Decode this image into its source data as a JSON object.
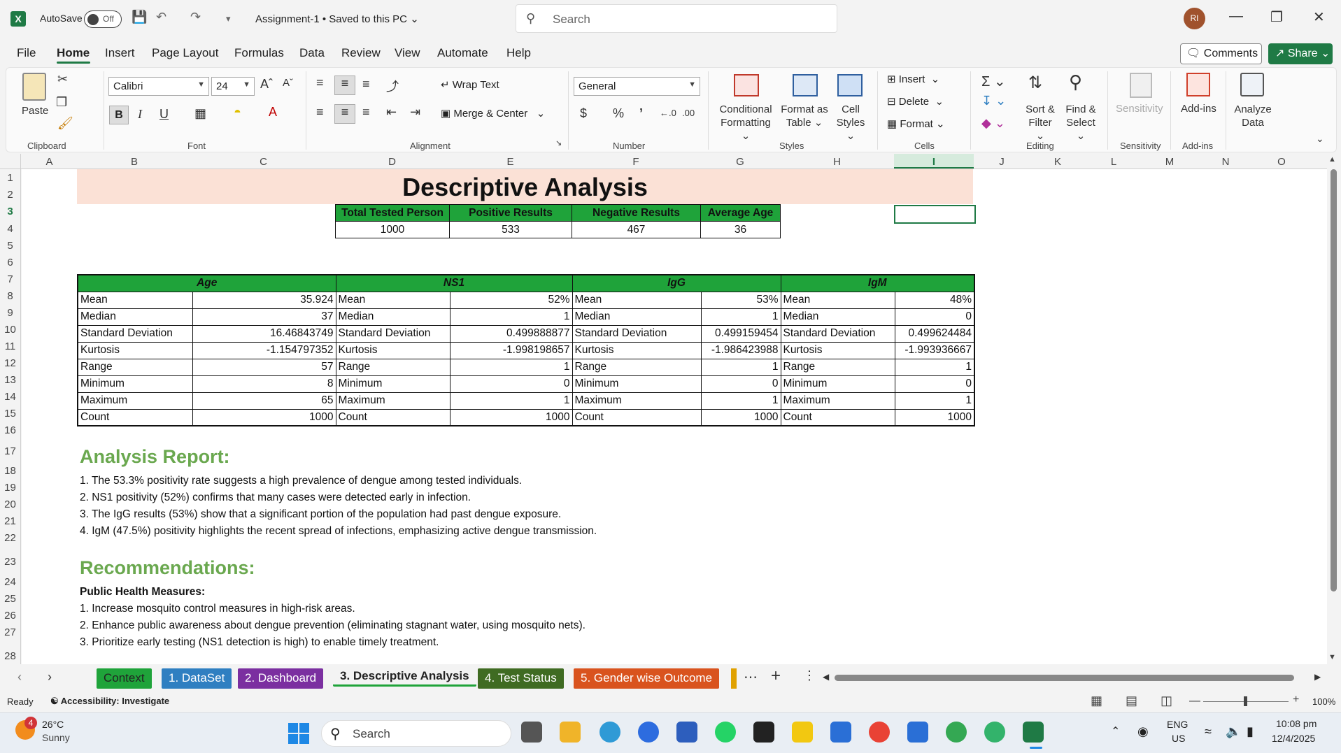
{
  "titlebar": {
    "autosave_label": "AutoSave",
    "autosave_state": "Off",
    "doc_title": "Assignment-1 • Saved to this PC",
    "search_placeholder": "Search",
    "avatar_initials": "RI"
  },
  "menu": {
    "tabs": [
      "File",
      "Home",
      "Insert",
      "Page Layout",
      "Formulas",
      "Data",
      "Review",
      "View",
      "Automate",
      "Help"
    ],
    "active": "Home",
    "comments_label": "Comments",
    "share_label": "Share"
  },
  "ribbon": {
    "paste_label": "Paste",
    "clipboard_group": "Clipboard",
    "font_name": "Calibri",
    "font_size": "24",
    "font_group": "Font",
    "wrap_text": "Wrap Text",
    "merge_center": "Merge & Center",
    "alignment_group": "Alignment",
    "number_format": "General",
    "number_group": "Number",
    "conditional_formatting": [
      "Conditional",
      "Formatting"
    ],
    "format_as_table": [
      "Format as",
      "Table"
    ],
    "cell_styles": [
      "Cell",
      "Styles"
    ],
    "styles_group": "Styles",
    "insert_label": "Insert",
    "delete_label": "Delete",
    "format_label": "Format",
    "cells_group": "Cells",
    "sort_filter": [
      "Sort &",
      "Filter"
    ],
    "find_select": [
      "Find &",
      "Select"
    ],
    "editing_group": "Editing",
    "sensitivity_label": "Sensitivity",
    "sensitivity_group": "Sensitivity",
    "addins_label": "Add-ins",
    "addins_group": "Add-ins",
    "analyze_data": [
      "Analyze",
      "Data"
    ],
    "accent_color": "#1f7a45"
  },
  "columns": [
    "A",
    "B",
    "C",
    "D",
    "E",
    "F",
    "G",
    "H",
    "I",
    "J",
    "K",
    "L",
    "M",
    "N",
    "O"
  ],
  "rows": [
    "1",
    "2",
    "3",
    "4",
    "5",
    "6",
    "7",
    "8",
    "9",
    "10",
    "11",
    "12",
    "13",
    "14",
    "15",
    "16",
    "17",
    "18",
    "19",
    "20",
    "21",
    "22",
    "23",
    "24",
    "25",
    "26",
    "27",
    "28"
  ],
  "sheet": {
    "title": "Descriptive Analysis",
    "summary_headers": [
      "Total Tested Person",
      "Positive Results",
      "Negative Results",
      "Average Age"
    ],
    "summary_values": [
      "1000",
      "533",
      "467",
      "36"
    ],
    "stat_groups": [
      "Age",
      "NS1",
      "IgG",
      "IgM"
    ],
    "stat_rows": [
      {
        "label": "Mean",
        "values": [
          "35.924",
          "52%",
          "53%",
          "48%"
        ]
      },
      {
        "label": "Median",
        "values": [
          "37",
          "1",
          "1",
          "0"
        ]
      },
      {
        "label": "Standard Deviation",
        "values": [
          "16.46843749",
          "0.499888877",
          "0.499159454",
          "0.499624484"
        ]
      },
      {
        "label": "Kurtosis",
        "values": [
          "-1.154797352",
          "-1.998198657",
          "-1.986423988",
          "-1.993936667"
        ]
      },
      {
        "label": "Range",
        "values": [
          "57",
          "1",
          "1",
          "1"
        ]
      },
      {
        "label": "Minimum",
        "values": [
          "8",
          "0",
          "0",
          "0"
        ]
      },
      {
        "label": "Maximum",
        "values": [
          "65",
          "1",
          "1",
          "1"
        ]
      },
      {
        "label": "Count",
        "values": [
          "1000",
          "1000",
          "1000",
          "1000"
        ]
      }
    ],
    "analysis_heading": "Analysis Report:",
    "analysis_items": [
      "1. The 53.3% positivity rate suggests a high prevalence of dengue among tested individuals.",
      "2. NS1 positivity (52%) confirms that many cases were detected early in infection.",
      "3. The IgG results (53%) show that a significant portion of the population had past dengue exposure.",
      "4. IgM (47.5%) positivity highlights the recent spread of infections, emphasizing active dengue transmission."
    ],
    "recommend_heading": "Recommendations:",
    "public_health_label": "Public Health Measures:",
    "recommend_items": [
      "1. Increase mosquito control measures in high-risk areas.",
      "2. Enhance public awareness about dengue prevention (eliminating stagnant water, using mosquito nets).",
      "3. Prioritize early testing (NS1 detection is high) to enable timely treatment."
    ],
    "header_fill": "#1fa33a",
    "title_fill": "#fbe1d6",
    "heading_color": "#6aa84f"
  },
  "sheet_tabs": [
    {
      "label": "Context",
      "color": "#1fa33a"
    },
    {
      "label": "1. DataSet",
      "color": "#2f7fc1"
    },
    {
      "label": "2. Dashboard",
      "color": "#7b2fa0"
    },
    {
      "label": "3. Descriptive Analysis",
      "color": ""
    },
    {
      "label": "4. Test Status",
      "color": "#3f6b22"
    },
    {
      "label": "5. Gender wise Outcome",
      "color": "#d9531e"
    }
  ],
  "status": {
    "ready": "Ready",
    "accessibility": "Accessibility: Investigate",
    "zoom": "100%"
  },
  "taskbar": {
    "weather_temp": "26°C",
    "weather_desc": "Sunny",
    "weather_badge": "4",
    "search_label": "Search",
    "lang_top": "ENG",
    "lang_bottom": "US",
    "time": "10:08 pm",
    "date": "12/4/2025"
  }
}
